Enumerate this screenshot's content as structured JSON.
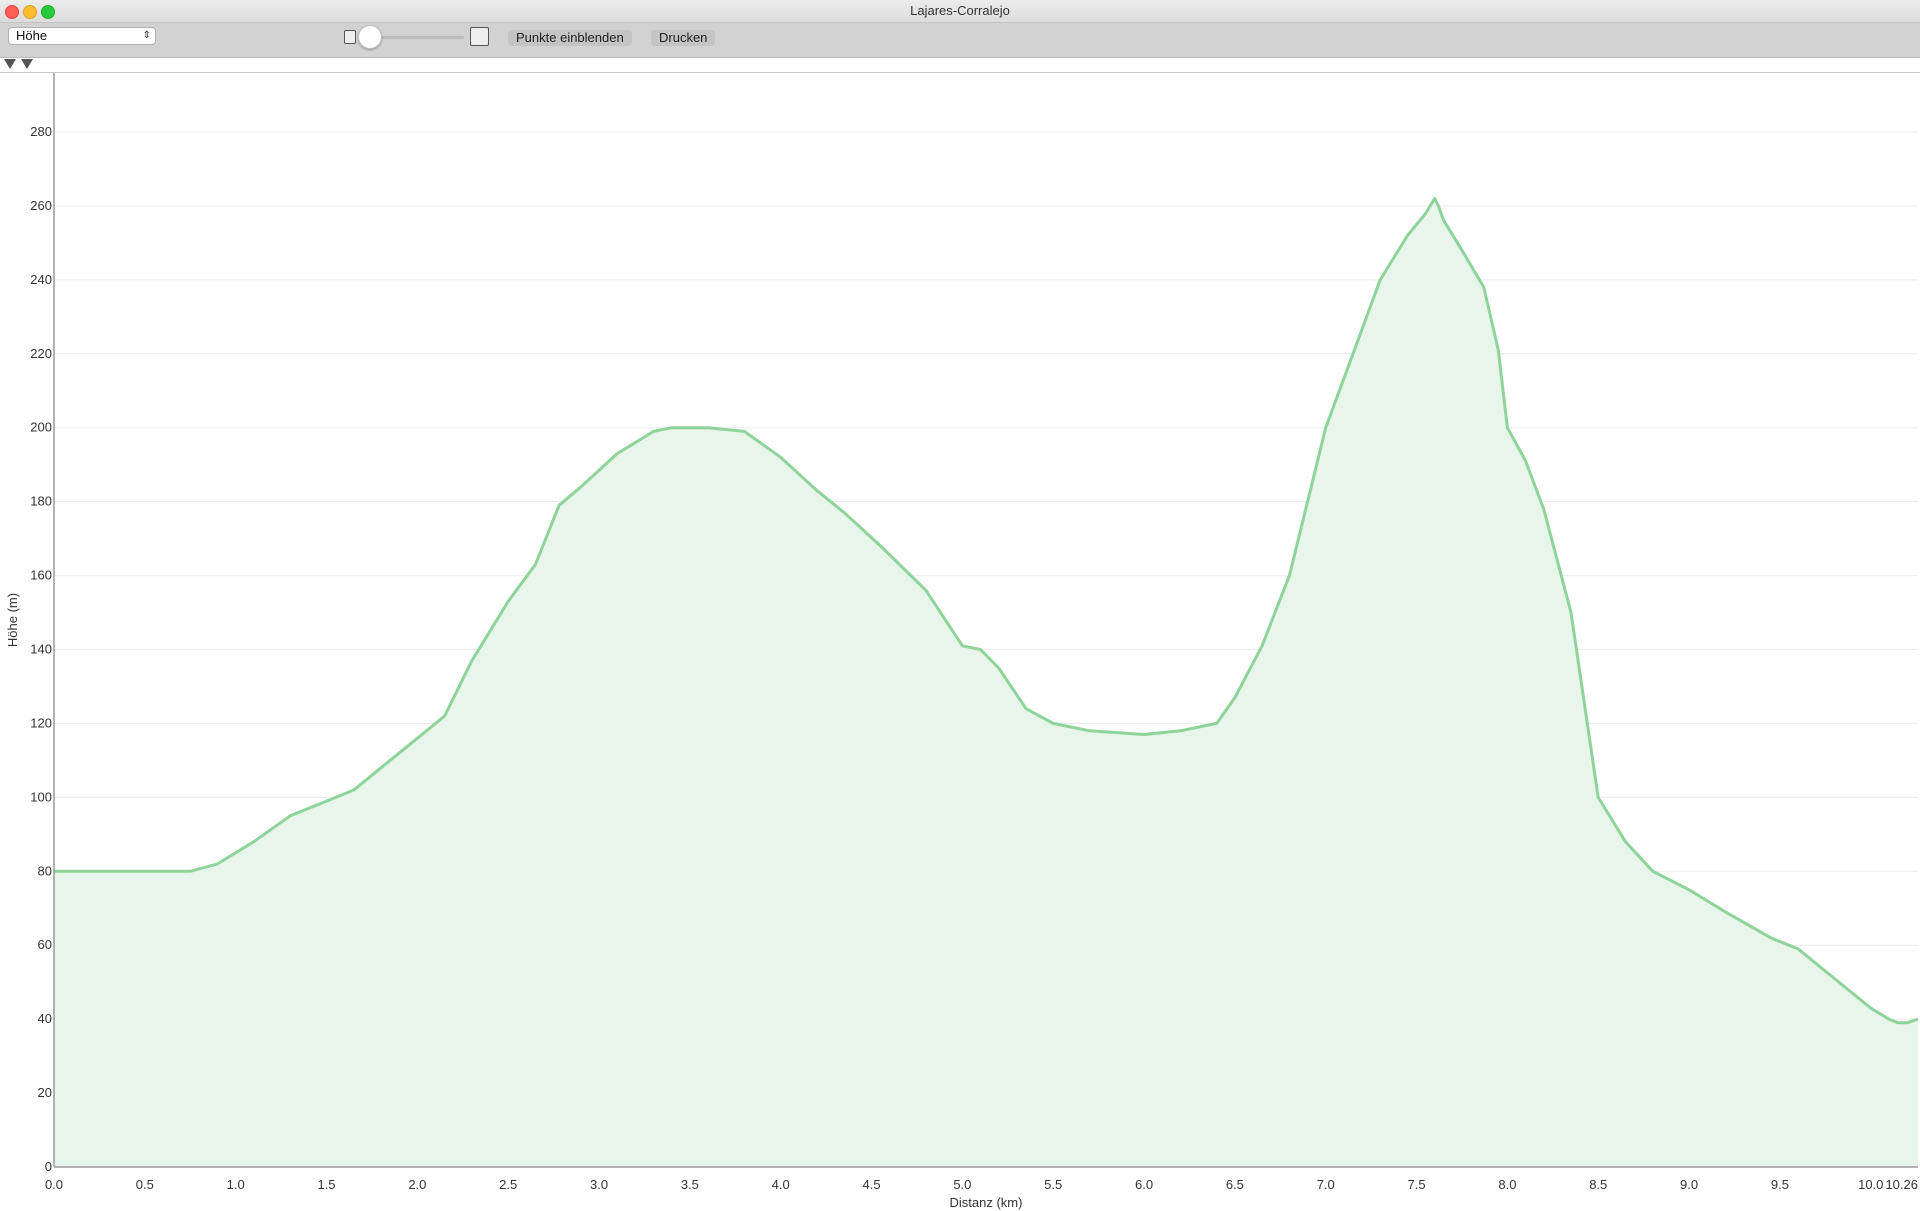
{
  "window": {
    "title": "Lajares-Corralejo"
  },
  "toolbar": {
    "select_value": "Höhe",
    "show_points_label": "Punkte einblenden",
    "print_label": "Drucken"
  },
  "colors": {
    "line": "#8ed49a",
    "fill": "#e8f5ea",
    "grid": "#ececec",
    "axis": "#9a9a9a"
  },
  "chart_data": {
    "type": "area",
    "title": "",
    "xlabel": "Distanz (km)",
    "ylabel": "Höhe (m)",
    "xlim": [
      0,
      10.26
    ],
    "ylim": [
      0,
      280
    ],
    "grid": true,
    "xticks": [
      0.0,
      0.5,
      1.0,
      1.5,
      2.0,
      2.5,
      3.0,
      3.5,
      4.0,
      4.5,
      5.0,
      5.5,
      6.0,
      6.5,
      7.0,
      7.5,
      8.0,
      8.5,
      9.0,
      9.5,
      10.0
    ],
    "xtick_labels": [
      "0.0",
      "0.5",
      "1.0",
      "1.5",
      "2.0",
      "2.5",
      "3.0",
      "3.5",
      "4.0",
      "4.5",
      "5.0",
      "5.5",
      "6.0",
      "6.5",
      "7.0",
      "7.5",
      "8.0",
      "8.5",
      "9.0",
      "9.5",
      "10.0",
      "10.26"
    ],
    "yticks": [
      0,
      20,
      40,
      60,
      80,
      100,
      120,
      140,
      160,
      180,
      200,
      220,
      240,
      260,
      280
    ],
    "series": [
      {
        "x": [
          0.0,
          0.3,
          0.6,
          0.75,
          0.9,
          1.1,
          1.3,
          1.5,
          1.65,
          1.8,
          2.0,
          2.15,
          2.3,
          2.5,
          2.65,
          2.78,
          2.9,
          3.1,
          3.3,
          3.4,
          3.6,
          3.8,
          4.0,
          4.2,
          4.35,
          4.55,
          4.8,
          5.0,
          5.1,
          5.2,
          5.35,
          5.5,
          5.7,
          6.0,
          6.2,
          6.4,
          6.5,
          6.65,
          6.8,
          6.9,
          7.0,
          7.15,
          7.3,
          7.45,
          7.55,
          7.6,
          7.62,
          7.65,
          7.75,
          7.87,
          7.95,
          8.0,
          8.1,
          8.2,
          8.35,
          8.5,
          8.65,
          8.8,
          9.0,
          9.2,
          9.45,
          9.6,
          9.8,
          10.0,
          10.1,
          10.15,
          10.2,
          10.26
        ],
        "y": [
          80,
          80,
          80,
          80,
          82,
          88,
          95,
          99,
          102,
          108,
          116,
          122,
          137,
          153,
          163,
          179,
          184,
          193,
          199,
          200,
          200,
          199,
          192,
          183,
          177,
          168,
          156,
          141,
          140,
          135,
          124,
          120,
          118,
          117,
          118,
          120,
          127,
          141,
          160,
          180,
          200,
          220,
          240,
          252,
          258,
          262,
          260,
          256,
          248,
          238,
          221,
          200,
          191,
          178,
          150,
          100,
          88,
          80,
          75,
          69,
          62,
          59,
          51,
          43,
          40,
          39,
          39,
          40
        ]
      }
    ]
  }
}
